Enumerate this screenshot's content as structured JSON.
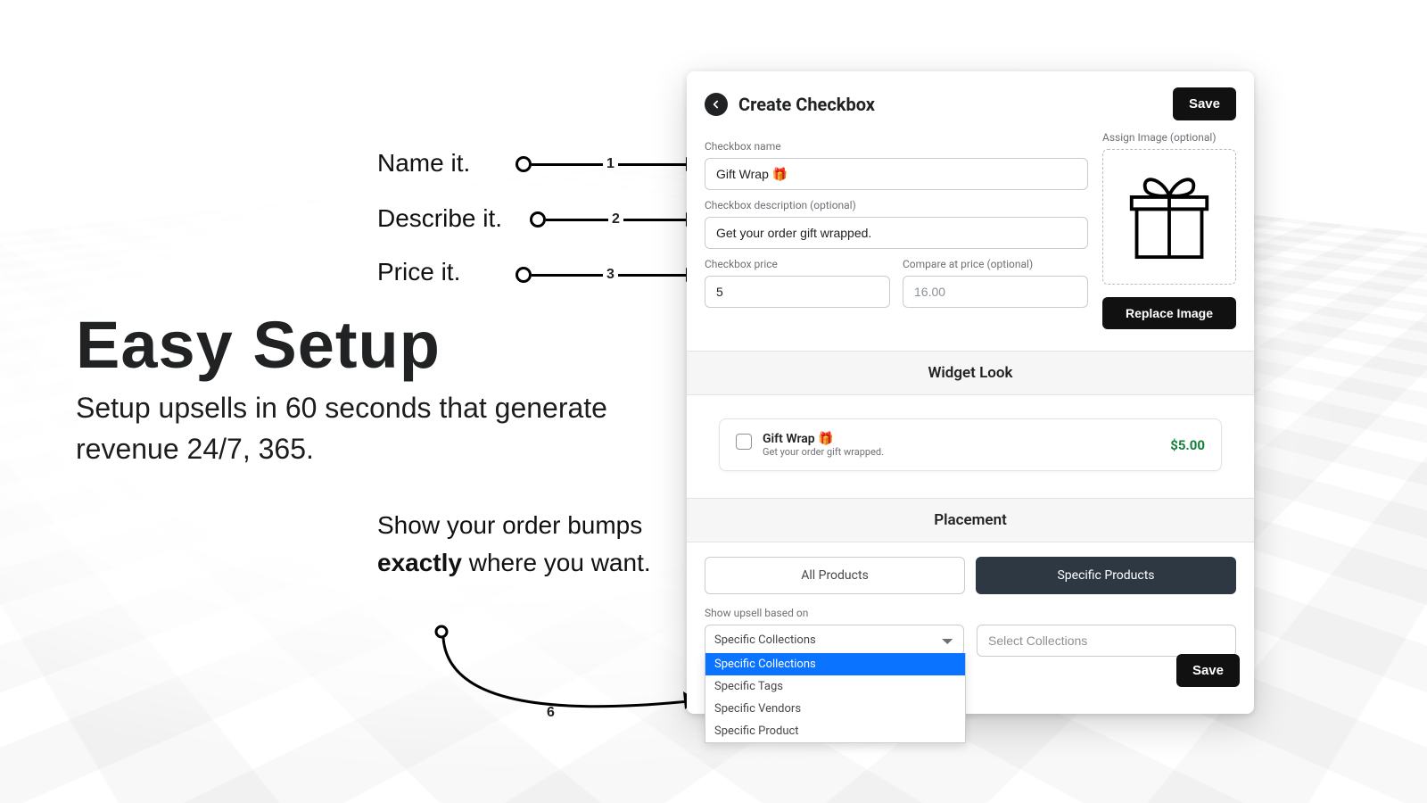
{
  "marketing": {
    "headline": "Easy Setup",
    "subline": "Setup upsells in 60 seconds that generate revenue 24/7, 365."
  },
  "steps": {
    "s1": {
      "label": "Name it.",
      "num": "1"
    },
    "s2": {
      "label": "Describe it.",
      "num": "2"
    },
    "s3": {
      "label": "Price it.",
      "num": "3"
    },
    "placement_lead": "Show your order bumps ",
    "placement_bold": "exactly",
    "placement_tail": " where you want.",
    "placement_num": "6"
  },
  "panel": {
    "title": "Create Checkbox",
    "save": "Save",
    "replace_image": "Replace Image",
    "assign_image_label": "Assign Image (optional)",
    "labels": {
      "name": "Checkbox name",
      "desc": "Checkbox description (optional)",
      "price": "Checkbox price",
      "compare": "Compare at price (optional)"
    },
    "values": {
      "name": "Gift Wrap 🎁",
      "desc": "Get your order gift wrapped.",
      "price": "5",
      "compare_placeholder": "16.00"
    }
  },
  "widget_look": {
    "section": "Widget Look",
    "title": "Gift Wrap 🎁",
    "sub": "Get your order gift wrapped.",
    "price": "$5.00"
  },
  "placement": {
    "section": "Placement",
    "all_products_tab": "All Products",
    "specific_products_tab": "Specific Products",
    "show_based_on_label": "Show upsell based on",
    "select_value": "Specific Collections",
    "select_collections_placeholder": "Select Collections",
    "options": {
      "o1": "Specific Collections",
      "o2": "Specific Tags",
      "o3": "Specific Vendors",
      "o4": "Specific Product"
    },
    "save": "Save"
  }
}
